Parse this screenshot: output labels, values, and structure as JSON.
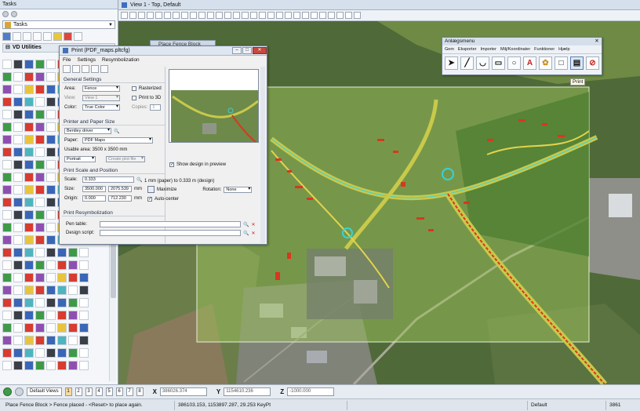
{
  "tasks": {
    "title": "Tasks",
    "combo": "Tasks",
    "section": "VD Utilities"
  },
  "view": {
    "title": "View 1 - Top, Default"
  },
  "behind_window": "Place Fence Block",
  "print": {
    "title": "Print  (PDF_maps.pltcfg)",
    "menu": [
      "File",
      "Settings",
      "Resymbolization"
    ],
    "general_settings": "General Settings",
    "area_label": "Area:",
    "area_value": "Fence",
    "view_label": "View:",
    "view_value": "View 1",
    "color_label": "Color:",
    "color_value": "True Color",
    "rasterized": "Rasterized",
    "print_to_3d": "Print to 3D",
    "copies_label": "Copies:",
    "copies_value": "1",
    "printer_paper": "Printer and Paper Size",
    "driver": "Bentley driver",
    "paper_label": "Paper:",
    "paper_value": "PDF Maps",
    "usable_area": "Usable area:  3500 x 3500 mm",
    "orientation": "Portrait",
    "create_plot_file": "Create plot file",
    "show_design": "Show design in preview",
    "scale_position": "Print Scale and Position",
    "scale_label": "Scale:",
    "scale_value": "0.333",
    "scale_text": "1 mm (paper) to 0.333 m (design)",
    "size_label": "Size:",
    "size_w": "3500.000",
    "size_h": "2075.539",
    "size_unit": "mm",
    "maximize": "Maximize",
    "rotation_label": "Rotation:",
    "rotation_value": "None",
    "origin_label": "Origin:",
    "origin_x": "0.000",
    "origin_y": "712.230",
    "origin_unit": "mm",
    "auto_center": "Auto-center",
    "resymbolization": "Print Resymbolization",
    "pen_table": "Pen table:",
    "design_script": "Design script:"
  },
  "anlaeg": {
    "title": "Anlægsmenu",
    "menu": [
      "Gem",
      "Eksporter",
      "Importer",
      "Milj/Koordinater",
      "Funktioner",
      "Hjælp"
    ]
  },
  "tooltip": "Print",
  "coordbar": {
    "views_label": "Default Views",
    "view_numbers": [
      "1",
      "2",
      "3",
      "4",
      "5",
      "6",
      "7",
      "8"
    ],
    "x_label": "X",
    "x_value": "386026.374",
    "y_label": "Y",
    "y_value": "1154610.236",
    "z_label": "Z",
    "z_value": "-1000.000"
  },
  "status": {
    "prompt": "Place Fence Block > Fence placed - <Reset> to place again.",
    "coords": "386103.153, 1153897.287, 29.253 KeyPt",
    "level": "Default",
    "right": "3861"
  },
  "colors": {
    "field_green": "#5a7a3e",
    "fence_overlay": "#96b35a",
    "road": "#c9c94a",
    "red_markup": "#d9371f",
    "cyan_markup": "#35d3d9"
  }
}
